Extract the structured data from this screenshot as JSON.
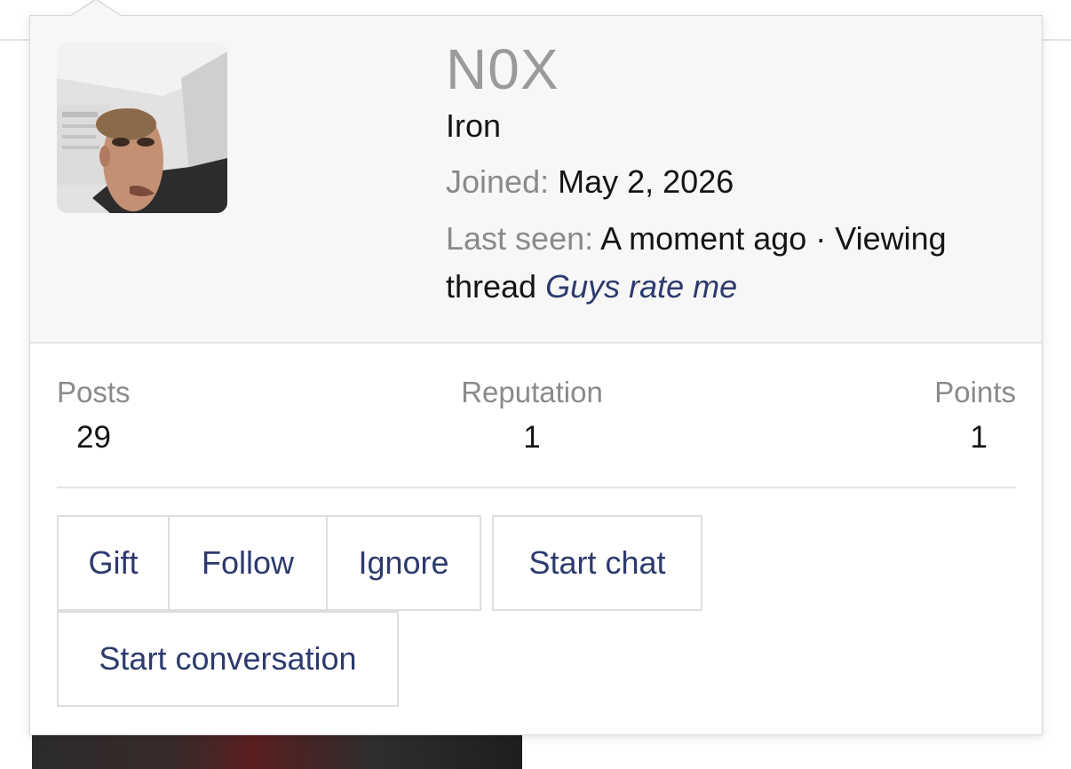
{
  "profile": {
    "username": "N0X",
    "rank": "Iron",
    "joined_label": "Joined:",
    "joined_value": "May 2, 2026",
    "last_seen_label": "Last seen:",
    "last_seen_value": "A moment ago · Viewing thread",
    "last_seen_link": "Guys rate me"
  },
  "stats": {
    "posts_label": "Posts",
    "posts_value": "29",
    "reputation_label": "Reputation",
    "reputation_value": "1",
    "points_label": "Points",
    "points_value": "1"
  },
  "actions": {
    "gift": "Gift",
    "follow": "Follow",
    "ignore": "Ignore",
    "start_chat": "Start chat",
    "start_conversation": "Start conversation"
  },
  "colors": {
    "link": "#2d3a6e",
    "muted": "#8a8a8a",
    "username": "#9a9a9a"
  }
}
